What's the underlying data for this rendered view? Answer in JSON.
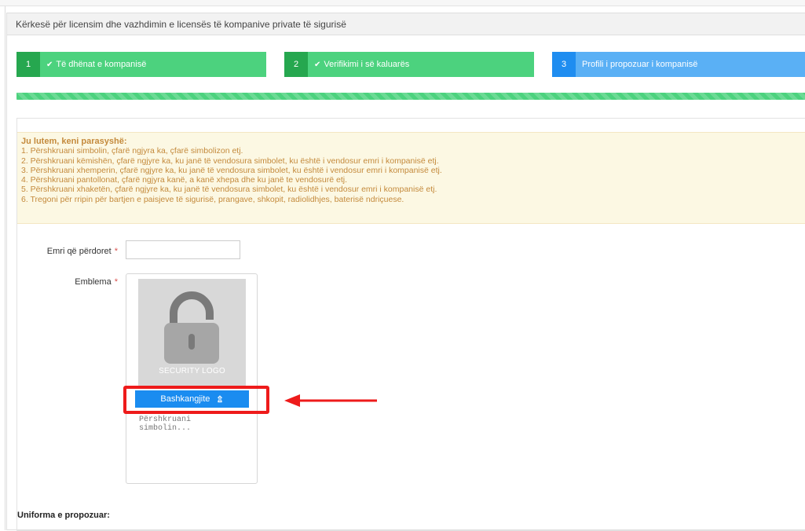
{
  "panel": {
    "heading": "Kërkesë për licensim dhe vazhdimin e licensës të kompanive private të sigurisë"
  },
  "steps": [
    {
      "number": "1",
      "label": "Të dhënat e kompanisë",
      "state": "done",
      "icon": "check-icon"
    },
    {
      "number": "2",
      "label": "Verifikimi i së kaluarës",
      "state": "done",
      "icon": "check-icon"
    },
    {
      "number": "3",
      "label": "Profili i propozuar i kompanisë",
      "state": "active"
    }
  ],
  "progress": {
    "percent": 100
  },
  "notice": {
    "title": "Ju lutem, keni parasyshë:",
    "items": [
      "1. Përshkruani simbolin, çfarë ngjyra ka, çfarë simbolizon etj.",
      "2. Përshkruani këmishën, çfarë ngjyre ka, ku janë të vendosura simbolet, ku është i vendosur emri i kompanisë etj.",
      "3. Përshkruani xhemperin, çfarë ngjyre ka, ku janë të vendosura simbolet, ku është i vendosur emri i kompanisë etj.",
      "4. Përshkruani pantollonat, çfarë ngjyra kanë, a kanë xhepa dhe ku janë te vendosurë etj.",
      "5. Përshkruani xhaketën, çfarë ngjyre ka, ku janë të vendosura simbolet, ku është i vendosur emri i kompanisë etj.",
      "6. Tregoni për rripin për bartjen e paisjeve të sigurisë, prangave, shkopit, radiolidhjes, baterisë ndriçuese."
    ]
  },
  "form": {
    "name_label": "Emri që përdoret",
    "name_value": "",
    "emblem_label": "Emblema",
    "required_mark": "*",
    "logo_placeholder_text": "SECURITY LOGO",
    "attach_label": "Bashkangjite",
    "description_placeholder": "Përshkruani simbolin...",
    "uniform_label": "Uniforma e propozuar:"
  },
  "colors": {
    "step_done": "#4cd27e",
    "step_active": "#5ab0f5",
    "attach_button": "#1a8cf0",
    "annotation": "#ee1b1b",
    "notice_text": "#c48a3c"
  }
}
